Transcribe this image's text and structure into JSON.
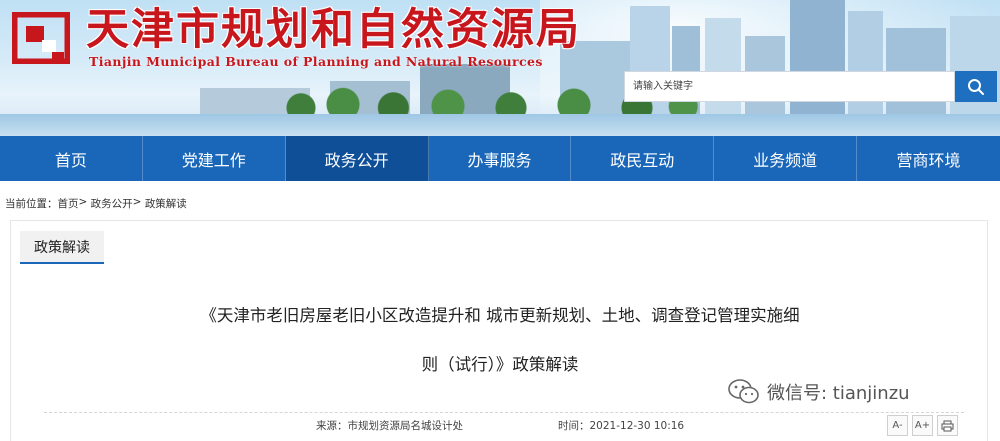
{
  "header": {
    "title": "天津市规划和自然资源局",
    "subtitle": "Tianjin Municipal Bureau of Planning and Natural Resources",
    "logo_icon": "bureau-logo-icon",
    "brand_color": "#c8161d"
  },
  "search": {
    "placeholder": "请输入关键字",
    "icon": "search-icon"
  },
  "nav": {
    "items": [
      {
        "label": "首页"
      },
      {
        "label": "党建工作"
      },
      {
        "label": "政务公开"
      },
      {
        "label": "办事服务"
      },
      {
        "label": "政民互动"
      },
      {
        "label": "业务频道"
      },
      {
        "label": "营商环境"
      }
    ],
    "active_index": 2,
    "color": "#1a67b9",
    "active_color": "#0e4f98"
  },
  "breadcrumb": {
    "prefix": "当前位置：",
    "items": [
      "首页",
      "政务公开",
      "政策解读"
    ],
    "separator": ">"
  },
  "section": {
    "tab_label": "政策解读"
  },
  "article": {
    "title_line1": "《天津市老旧房屋老旧小区改造提升和 城市更新规划、土地、调查登记管理实施细",
    "title_line2": "则（试行）》政策解读",
    "source": "来源：市规划资源局名城设计处",
    "time": "时间：2021-12-30 10:16"
  },
  "watermark": {
    "text": "微信号: tianjinzu",
    "icon": "wechat-icon"
  },
  "tools": [
    {
      "label": "A-",
      "icon": "font-decrease-icon"
    },
    {
      "label": "A+",
      "icon": "font-increase-icon"
    },
    {
      "label": "",
      "icon": "print-icon"
    }
  ]
}
